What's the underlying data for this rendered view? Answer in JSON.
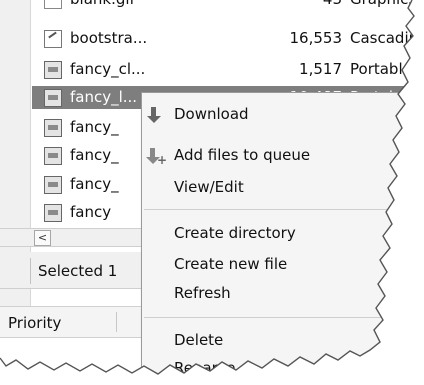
{
  "file_list": {
    "rows": [
      {
        "name": "blank.gif",
        "size": "43",
        "type": "Graphics Interchange",
        "icon": "gif-file-icon"
      },
      {
        "name": "bootstra...",
        "size": "16,553",
        "type": "Cascading",
        "icon": "css-file-icon"
      },
      {
        "name": "fancy_cl...",
        "size": "1,517",
        "type": "Portable N",
        "icon": "png-file-icon"
      },
      {
        "name": "fancy_l...",
        "size": "10,487",
        "type": "Portable N",
        "icon": "png-file-icon"
      },
      {
        "name": "fancy_",
        "size": "",
        "type": "",
        "icon": "png-file-icon"
      },
      {
        "name": "fancy_",
        "size": "",
        "type": "",
        "icon": "png-file-icon"
      },
      {
        "name": "fancy_",
        "size": "",
        "type": "",
        "icon": "png-file-icon"
      },
      {
        "name": "fancy",
        "size": "",
        "type": "",
        "icon": "png-file-icon"
      }
    ]
  },
  "scroll": {
    "left_glyph": "<"
  },
  "status": {
    "text": "Selected 1"
  },
  "queue": {
    "priority_label": "Priority"
  },
  "context_menu": {
    "download": "Download",
    "add_to_queue": "Add files to queue",
    "view_edit": "View/Edit",
    "create_directory": "Create directory",
    "create_new_file": "Create new file",
    "refresh": "Refresh",
    "delete": "Delete",
    "rename": "Rename"
  }
}
